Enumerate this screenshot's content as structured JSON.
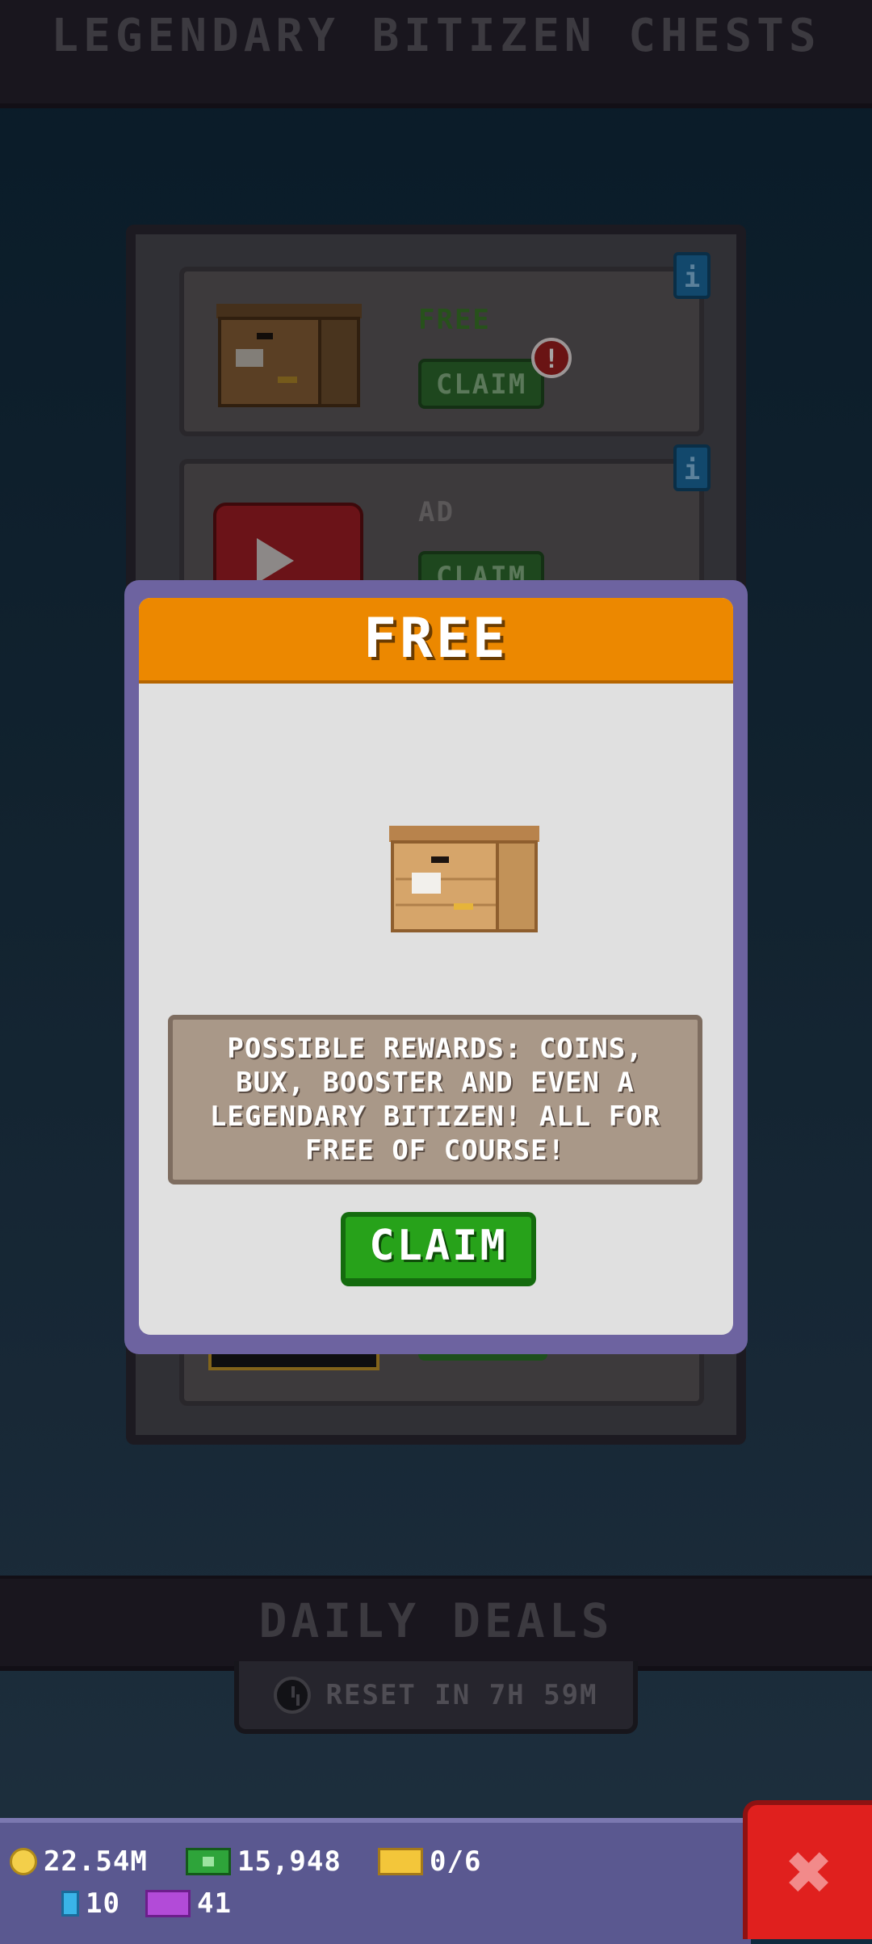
{
  "header": {
    "title": "LEGENDARY BITIZEN CHESTS"
  },
  "chest_list": {
    "cards": [
      {
        "label": "FREE",
        "claim_label": "CLAIM",
        "alert": "!",
        "info": "i"
      },
      {
        "label": "AD",
        "claim_label": "CLAIM",
        "info": "i"
      }
    ]
  },
  "modal": {
    "title": "FREE",
    "rewards_text": "POSSIBLE REWARDS: COINS, BUX, BOOSTER AND EVEN A LEGENDARY BITIZEN! ALL FOR FREE OF COURSE!",
    "claim_label": "CLAIM"
  },
  "daily_deals": {
    "title": "DAILY DEALS",
    "reset_text": "RESET IN 7H 59M"
  },
  "resources": {
    "coins": "22.54M",
    "bux": "15,948",
    "tickets": "0/6",
    "gems": "10",
    "vip_tickets": "41"
  },
  "colors": {
    "accent_orange": "#ec8800",
    "claim_green": "#27a21a",
    "close_red": "#e0201e",
    "modal_border": "#6d63a0"
  },
  "icons": {
    "close": "close-icon",
    "coin": "coin-icon",
    "bux": "bux-icon",
    "ticket": "golden-ticket-icon",
    "gem": "gem-icon",
    "vip_ticket": "vip-ticket-icon",
    "clock": "clock-icon",
    "info": "info-icon"
  }
}
